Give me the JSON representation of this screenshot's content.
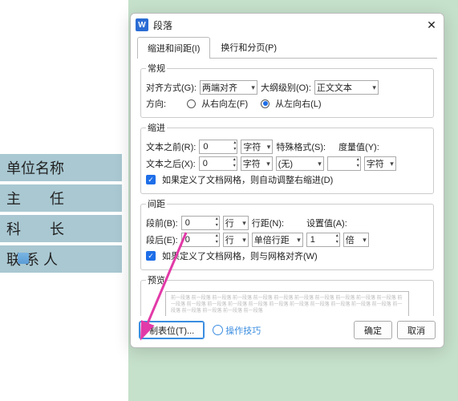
{
  "doc_lines": [
    "单位名称",
    "主　　任",
    "科　　长",
    "联 系 人"
  ],
  "dialog": {
    "title": "段落",
    "tabs": {
      "indent": "缩进和间距(I)",
      "page": "换行和分页(P)"
    },
    "groups": {
      "general": "常规",
      "indent": "缩进",
      "spacing": "间距",
      "preview": "预览"
    },
    "general": {
      "align_label": "对齐方式(G):",
      "align_value": "两端对齐",
      "outline_label": "大纲级别(O):",
      "outline_value": "正文文本",
      "direction_label": "方向:",
      "rtl": "从右向左(F)",
      "ltr": "从左向右(L)"
    },
    "indent": {
      "before_label": "文本之前(R):",
      "before_value": "0",
      "after_label": "文本之后(X):",
      "after_value": "0",
      "char_unit": "字符",
      "special_label": "特殊格式(S):",
      "special_value": "(无)",
      "measure_label": "度量值(Y):",
      "measure_value": "",
      "auto_adjust": "如果定义了文档网格，则自动调整右缩进(D)"
    },
    "spacing": {
      "before_label": "段前(B):",
      "before_value": "0",
      "after_label": "段后(E):",
      "after_value": "0",
      "line_unit": "行",
      "linespacing_label": "行距(N):",
      "linespacing_value": "单倍行距",
      "setvalue_label": "设置值(A):",
      "setvalue_value": "1",
      "setvalue_unit": "倍",
      "snap_grid": "如果定义了文档网格，则与网格对齐(W)"
    },
    "preview_text": "前一段落 前一段落 前一段落 前一段落 前一段落 前一段落 前一段落 前一段落 前一段落 前一段落 前一段落 前一段落 前一段落 前一段落 前一段落 前一段落 前一段落 前一段落 前一段落 前一段落 前一段落 前一段落 前一段落 前一段落 前一段落 前一段落 前一段落",
    "buttons": {
      "tabs": "制表位(T)...",
      "tips": "操作技巧",
      "ok": "确定",
      "cancel": "取消"
    }
  }
}
